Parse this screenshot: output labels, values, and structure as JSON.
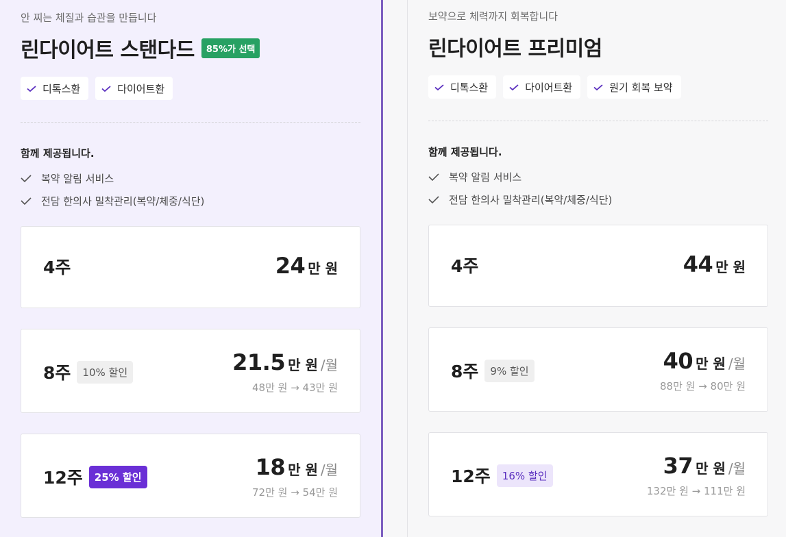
{
  "standard": {
    "subtitle": "안 찌는 체질과 습관을 만듭니다",
    "title": "린다이어트 스탠다드",
    "select_badge": "85%가 선택",
    "chips": [
      "디톡스환",
      "다이어트환"
    ],
    "provided_title": "함께 제공됩니다.",
    "features": [
      "복약 알림 서비스",
      "전담 한의사 밀착관리(복약/체중/식단)"
    ],
    "plans": [
      {
        "weeks": "4주",
        "price": "24",
        "unit": "만 원"
      },
      {
        "weeks": "8주",
        "discount": "10% 할인",
        "price": "21.5",
        "unit": "만 원",
        "per": "/월",
        "sub": "48만 원 → 43만 원"
      },
      {
        "weeks": "12주",
        "discount": "25% 할인",
        "price": "18",
        "unit": "만 원",
        "per": "/월",
        "sub": "72만 원 → 54만 원"
      }
    ]
  },
  "premium": {
    "subtitle": "보약으로 체력까지 회복합니다",
    "title": "린다이어트 프리미엄",
    "chips": [
      "디톡스환",
      "다이어트환",
      "원기 회복 보약"
    ],
    "provided_title": "함께 제공됩니다.",
    "features": [
      "복약 알림 서비스",
      "전담 한의사 밀착관리(복약/체중/식단)"
    ],
    "plans": [
      {
        "weeks": "4주",
        "price": "44",
        "unit": "만 원"
      },
      {
        "weeks": "8주",
        "discount": "9% 할인",
        "price": "40",
        "unit": "만 원",
        "per": "/월",
        "sub": "88만 원 → 80만 원"
      },
      {
        "weeks": "12주",
        "discount": "16% 할인",
        "price": "37",
        "unit": "만 원",
        "per": "/월",
        "sub": "132만 원 → 111만 원"
      }
    ]
  },
  "colors": {
    "accent_purple": "#6a2fd6",
    "select_green": "#27a163",
    "left_bg": "#f3f0fd",
    "divider_purple": "#7d5fc0"
  }
}
